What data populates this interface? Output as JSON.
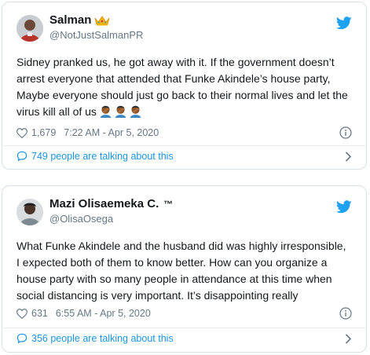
{
  "tweets": [
    {
      "display_name": "Salman",
      "badge_icon": "crown-icon",
      "handle": "@NotJustSalmanPR",
      "text": "Sidney pranked us, he got away with it. If the government doesn’t arrest everyone that attended that Funke Akindele’s house party, Maybe everyone should just go back to their normal lives and let the virus kill all of us",
      "emoji": [
        "🤦🏾‍♂️",
        "🤦🏾‍♂️",
        "🤦🏾‍♂️"
      ],
      "likes": "1,679",
      "timestamp": "7:22 AM - Apr 5, 2020",
      "talking": "749 people are talking about this"
    },
    {
      "display_name": "Mazi Olisaemeka C.",
      "trademark": "™",
      "handle": "@OlisaOsega",
      "text": "What Funke Akindele and the husband did was highly irresponsible, I expected both of them to know better. How can you organize a house party with so many people in attendance at this time when social distancing is very important. It’s disappointing really",
      "likes": "631",
      "timestamp": "6:55 AM - Apr 5, 2020",
      "talking": "356 people are talking about this"
    }
  ],
  "colors": {
    "twitter_blue": "#1da1f2",
    "link_blue": "#1b95e0",
    "muted": "#657786"
  }
}
